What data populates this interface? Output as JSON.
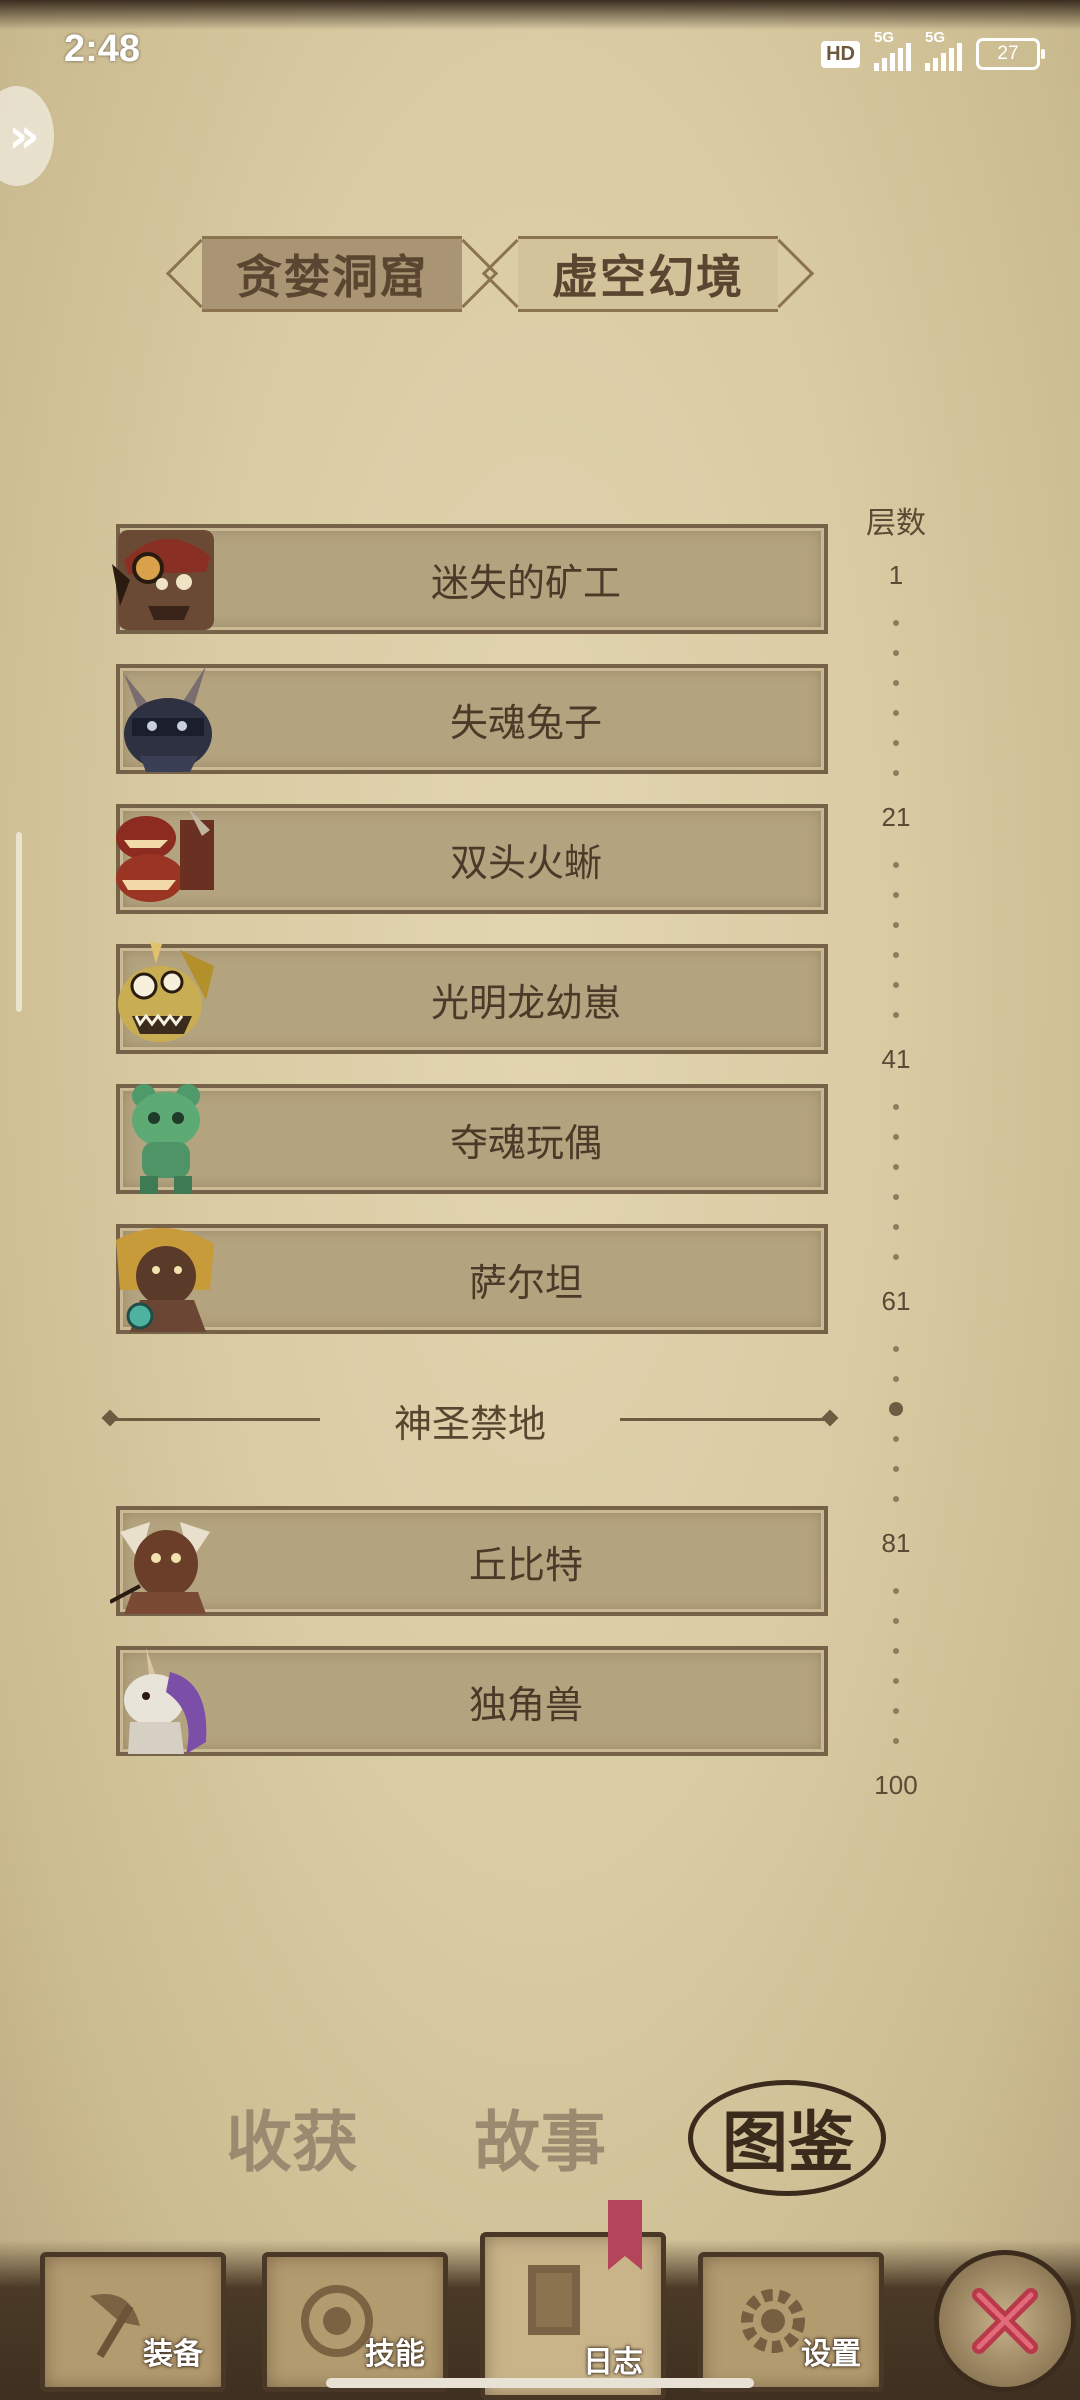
{
  "status_bar": {
    "time": "2:48",
    "hd_label": "HD",
    "signal1_label": "5G",
    "signal2_label": "5G",
    "battery": "27"
  },
  "region_tabs": [
    {
      "label": "贪婪洞窟",
      "selected": true
    },
    {
      "label": "虚空幻境",
      "selected": false
    }
  ],
  "floor_column": {
    "label": "层数",
    "marks": [
      "1",
      "21",
      "41",
      "61",
      "81",
      "100"
    ]
  },
  "monsters": [
    {
      "name": "迷失的矿工",
      "portrait": "miner-portrait-icon"
    },
    {
      "name": "失魂兔子",
      "portrait": "rabbit-portrait-icon"
    },
    {
      "name": "双头火蜥",
      "portrait": "fire-lizard-portrait-icon"
    },
    {
      "name": "光明龙幼崽",
      "portrait": "light-dragon-portrait-icon"
    },
    {
      "name": "夺魂玩偶",
      "portrait": "soul-doll-portrait-icon"
    },
    {
      "name": "萨尔坦",
      "portrait": "sultan-portrait-icon"
    }
  ],
  "sacred_section": {
    "label": "神圣禁地",
    "monsters": [
      {
        "name": "丘比特",
        "portrait": "cupid-portrait-icon"
      },
      {
        "name": "独角兽",
        "portrait": "unicorn-portrait-icon"
      }
    ]
  },
  "category_tabs": [
    {
      "label": "收获",
      "selected": false
    },
    {
      "label": "故事",
      "selected": false
    },
    {
      "label": "图鉴",
      "selected": true
    }
  ],
  "bottom_nav": {
    "equipment": "装备",
    "skills": "技能",
    "journal": "日志",
    "settings": "设置"
  },
  "colors": {
    "parchment": "#d9cba3",
    "entry_bg": "#b4a37f",
    "ink": "#4b3a28",
    "accent_red": "#b34459"
  }
}
